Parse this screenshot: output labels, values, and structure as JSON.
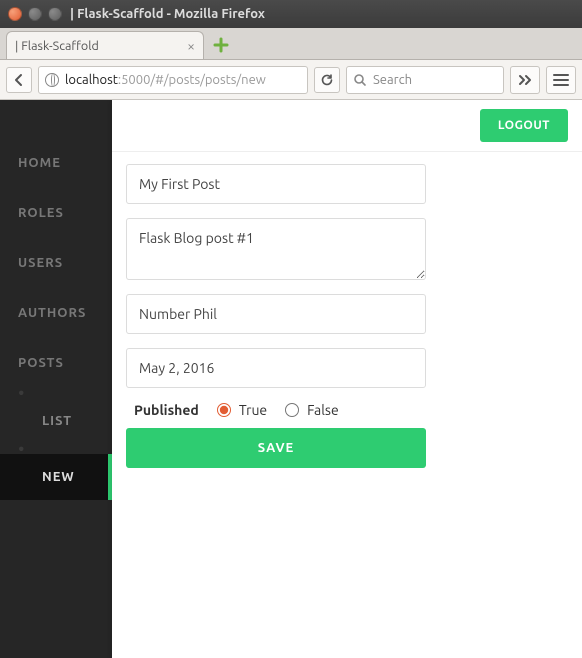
{
  "window": {
    "title": "| Flask-Scaffold - Mozilla Firefox"
  },
  "tab": {
    "title": "| Flask-Scaffold"
  },
  "url": {
    "host": "localhost",
    "rest": ":5000/#/posts/posts/new"
  },
  "search": {
    "placeholder": "Search"
  },
  "sidebar": {
    "items": [
      {
        "label": "HOME"
      },
      {
        "label": "ROLES"
      },
      {
        "label": "USERS"
      },
      {
        "label": "AUTHORS"
      },
      {
        "label": "POSTS"
      }
    ],
    "subitems": [
      {
        "label": "LIST"
      },
      {
        "label": "NEW"
      }
    ]
  },
  "header": {
    "logout": "LOGOUT"
  },
  "form": {
    "title_value": "My First Post",
    "body_value": "Flask Blog post #1",
    "author_value": "Number Phil",
    "date_value": "May 2, 2016",
    "published_label": "Published",
    "true_label": "True",
    "false_label": "False",
    "save_label": "SAVE"
  }
}
